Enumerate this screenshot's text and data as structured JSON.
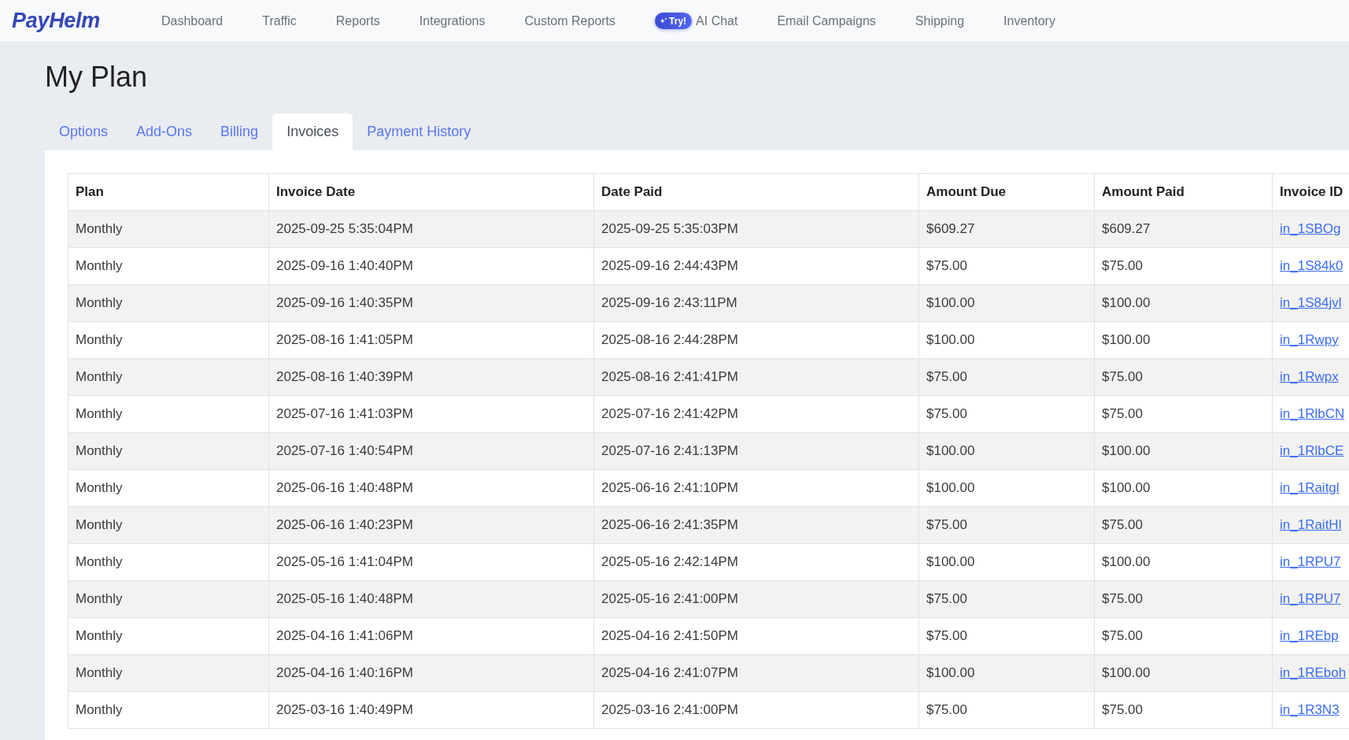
{
  "nav": {
    "logo": "PayHelm",
    "items": [
      {
        "label": "Dashboard"
      },
      {
        "label": "Traffic"
      },
      {
        "label": "Reports"
      },
      {
        "label": "Integrations"
      },
      {
        "label": "Custom Reports"
      },
      {
        "label": "AI Chat",
        "badge": "Try!"
      },
      {
        "label": "Email Campaigns"
      },
      {
        "label": "Shipping"
      },
      {
        "label": "Inventory"
      }
    ]
  },
  "page": {
    "title": "My Plan"
  },
  "tabs": [
    {
      "label": "Options",
      "selected": false
    },
    {
      "label": "Add-Ons",
      "selected": false
    },
    {
      "label": "Billing",
      "selected": false
    },
    {
      "label": "Invoices",
      "selected": true
    },
    {
      "label": "Payment History",
      "selected": false
    }
  ],
  "table": {
    "columns": [
      "Plan",
      "Invoice Date",
      "Date Paid",
      "Amount Due",
      "Amount Paid",
      "Invoice ID"
    ],
    "rows": [
      {
        "plan": "Monthly",
        "invoice_date": "2025-09-25 5:35:04PM",
        "date_paid": "2025-09-25 5:35:03PM",
        "amount_due": "$609.27",
        "amount_paid": "$609.27",
        "invoice_id": "in_1SBOg"
      },
      {
        "plan": "Monthly",
        "invoice_date": "2025-09-16 1:40:40PM",
        "date_paid": "2025-09-16 2:44:43PM",
        "amount_due": "$75.00",
        "amount_paid": "$75.00",
        "invoice_id": "in_1S84k0"
      },
      {
        "plan": "Monthly",
        "invoice_date": "2025-09-16 1:40:35PM",
        "date_paid": "2025-09-16 2:43:11PM",
        "amount_due": "$100.00",
        "amount_paid": "$100.00",
        "invoice_id": "in_1S84jvl"
      },
      {
        "plan": "Monthly",
        "invoice_date": "2025-08-16 1:41:05PM",
        "date_paid": "2025-08-16 2:44:28PM",
        "amount_due": "$100.00",
        "amount_paid": "$100.00",
        "invoice_id": "in_1Rwpy"
      },
      {
        "plan": "Monthly",
        "invoice_date": "2025-08-16 1:40:39PM",
        "date_paid": "2025-08-16 2:41:41PM",
        "amount_due": "$75.00",
        "amount_paid": "$75.00",
        "invoice_id": "in_1Rwpx"
      },
      {
        "plan": "Monthly",
        "invoice_date": "2025-07-16 1:41:03PM",
        "date_paid": "2025-07-16 2:41:42PM",
        "amount_due": "$75.00",
        "amount_paid": "$75.00",
        "invoice_id": "in_1RlbCN"
      },
      {
        "plan": "Monthly",
        "invoice_date": "2025-07-16 1:40:54PM",
        "date_paid": "2025-07-16 2:41:13PM",
        "amount_due": "$100.00",
        "amount_paid": "$100.00",
        "invoice_id": "in_1RlbCE"
      },
      {
        "plan": "Monthly",
        "invoice_date": "2025-06-16 1:40:48PM",
        "date_paid": "2025-06-16 2:41:10PM",
        "amount_due": "$100.00",
        "amount_paid": "$100.00",
        "invoice_id": "in_1Raitgl"
      },
      {
        "plan": "Monthly",
        "invoice_date": "2025-06-16 1:40:23PM",
        "date_paid": "2025-06-16 2:41:35PM",
        "amount_due": "$75.00",
        "amount_paid": "$75.00",
        "invoice_id": "in_1RaitHl"
      },
      {
        "plan": "Monthly",
        "invoice_date": "2025-05-16 1:41:04PM",
        "date_paid": "2025-05-16 2:42:14PM",
        "amount_due": "$100.00",
        "amount_paid": "$100.00",
        "invoice_id": "in_1RPU7"
      },
      {
        "plan": "Monthly",
        "invoice_date": "2025-05-16 1:40:48PM",
        "date_paid": "2025-05-16 2:41:00PM",
        "amount_due": "$75.00",
        "amount_paid": "$75.00",
        "invoice_id": "in_1RPU7"
      },
      {
        "plan": "Monthly",
        "invoice_date": "2025-04-16 1:41:06PM",
        "date_paid": "2025-04-16 2:41:50PM",
        "amount_due": "$75.00",
        "amount_paid": "$75.00",
        "invoice_id": "in_1REbp"
      },
      {
        "plan": "Monthly",
        "invoice_date": "2025-04-16 1:40:16PM",
        "date_paid": "2025-04-16 2:41:07PM",
        "amount_due": "$100.00",
        "amount_paid": "$100.00",
        "invoice_id": "in_1REboh"
      },
      {
        "plan": "Monthly",
        "invoice_date": "2025-03-16 1:40:49PM",
        "date_paid": "2025-03-16 2:41:00PM",
        "amount_due": "$75.00",
        "amount_paid": "$75.00",
        "invoice_id": "in_1R3N3"
      }
    ]
  }
}
